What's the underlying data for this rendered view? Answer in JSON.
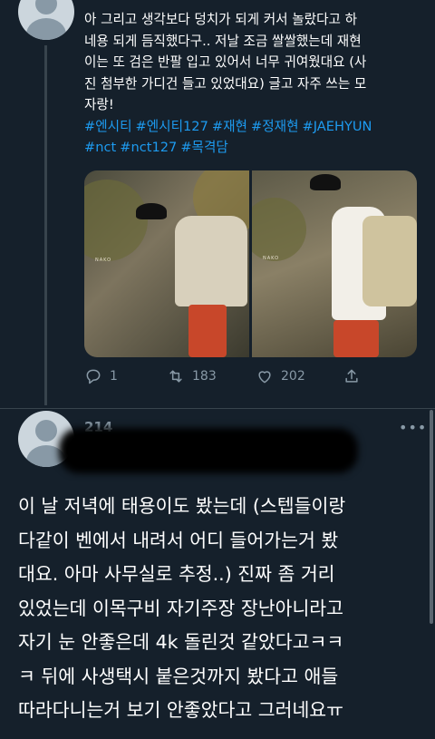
{
  "tweet1": {
    "lines": [
      "아 그리고 생각보다 덩치가 되게 커서 놀랐다고 하",
      "네용 되게 듬직했다구.. 저날 조금 쌀쌀했는데 재현",
      "이는 또 검은 반팔 입고 있어서 너무 귀여웠대요 (사",
      "진 첨부한 가디건 들고 있었대요) 글고 자주 쓰는 모",
      "자랑!"
    ],
    "hashtags_line1": [
      "#엔시티",
      "#엔시티127",
      "#재현",
      "#정재현",
      "#JAEHYUN"
    ],
    "hashtags_line2": [
      "#nct",
      "#nct127",
      "#목격담"
    ],
    "photo1_watermark": "NAKO",
    "photo2_watermark": "NAKO",
    "actions": {
      "reply_count": "1",
      "retweet_count": "183",
      "like_count": "202"
    }
  },
  "tweet2": {
    "name": "214",
    "more": "•••",
    "lines": [
      "이 날 저녁에 태용이도 봤는데 (스텝들이랑",
      "다같이 벤에서 내려서 어디 들어가는거 봤",
      "대요. 아마 사무실로 추정..) 진짜 좀 거리",
      "있었는데 이목구비 자기주장 장난아니라고",
      "자기 눈 안좋은데 4k 돌린것 같았다고ㅋㅋ",
      "ㅋ 뒤에 사생택시 붙은것까지 봤다고 애들",
      "따라다니는거 보기 안좋았다고 그러네요ㅠ"
    ]
  },
  "colors": {
    "background": "#15202b",
    "hashtag": "#1d9bf0",
    "muted": "#8899a6",
    "divider": "#38444d"
  },
  "icons": [
    "reply-icon",
    "retweet-icon",
    "like-icon",
    "share-icon",
    "more-icon",
    "default-avatar-icon"
  ]
}
